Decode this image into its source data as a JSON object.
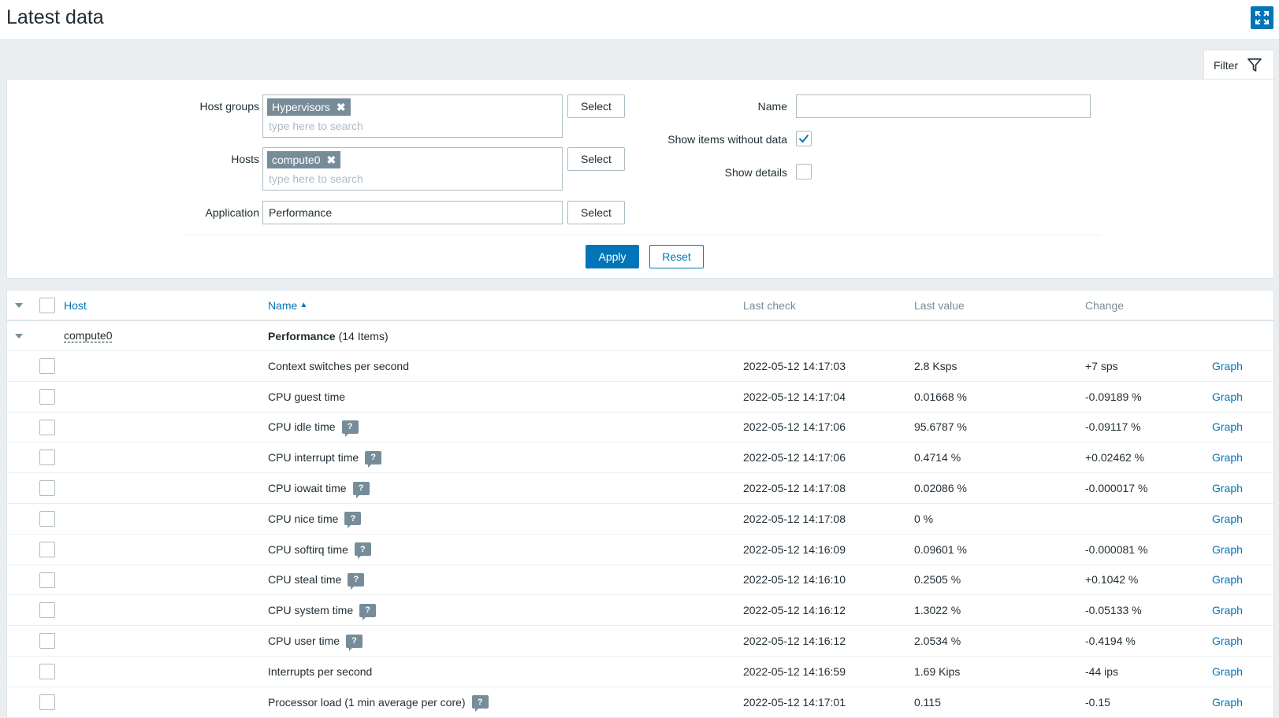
{
  "page": {
    "title": "Latest data"
  },
  "filter": {
    "tab_label": "Filter",
    "host_groups_label": "Host groups",
    "host_groups_tag": "Hypervisors",
    "hosts_label": "Hosts",
    "hosts_tag": "compute0",
    "search_placeholder": "type here to search",
    "application_label": "Application",
    "application_value": "Performance",
    "select_label": "Select",
    "name_label": "Name",
    "name_value": "",
    "show_items_without_data_label": "Show items without data",
    "show_items_without_data_checked": true,
    "show_details_label": "Show details",
    "show_details_checked": false,
    "apply_label": "Apply",
    "reset_label": "Reset"
  },
  "table": {
    "headers": {
      "host": "Host",
      "name": "Name",
      "sort_indicator": "▲",
      "last_check": "Last check",
      "last_value": "Last value",
      "change": "Change"
    },
    "group": {
      "host": "compute0",
      "application": "Performance",
      "count": "(14 Items)"
    },
    "graph_label": "Graph",
    "rows": [
      {
        "name": "Context switches per second",
        "hint": false,
        "last_check": "2022-05-12 14:17:03",
        "last_value": "2.8 Ksps",
        "change": "+7 sps"
      },
      {
        "name": "CPU guest time",
        "hint": false,
        "last_check": "2022-05-12 14:17:04",
        "last_value": "0.01668 %",
        "change": "-0.09189 %"
      },
      {
        "name": "CPU idle time",
        "hint": true,
        "last_check": "2022-05-12 14:17:06",
        "last_value": "95.6787 %",
        "change": "-0.09117 %"
      },
      {
        "name": "CPU interrupt time",
        "hint": true,
        "last_check": "2022-05-12 14:17:06",
        "last_value": "0.4714 %",
        "change": "+0.02462 %"
      },
      {
        "name": "CPU iowait time",
        "hint": true,
        "last_check": "2022-05-12 14:17:08",
        "last_value": "0.02086 %",
        "change": "-0.000017 %"
      },
      {
        "name": "CPU nice time",
        "hint": true,
        "last_check": "2022-05-12 14:17:08",
        "last_value": "0 %",
        "change": ""
      },
      {
        "name": "CPU softirq time",
        "hint": true,
        "last_check": "2022-05-12 14:16:09",
        "last_value": "0.09601 %",
        "change": "-0.000081 %"
      },
      {
        "name": "CPU steal time",
        "hint": true,
        "last_check": "2022-05-12 14:16:10",
        "last_value": "0.2505 %",
        "change": "+0.1042 %"
      },
      {
        "name": "CPU system time",
        "hint": true,
        "last_check": "2022-05-12 14:16:12",
        "last_value": "1.3022 %",
        "change": "-0.05133 %"
      },
      {
        "name": "CPU user time",
        "hint": true,
        "last_check": "2022-05-12 14:16:12",
        "last_value": "2.0534 %",
        "change": "-0.4194 %"
      },
      {
        "name": "Interrupts per second",
        "hint": false,
        "last_check": "2022-05-12 14:16:59",
        "last_value": "1.69 Kips",
        "change": "-44 ips"
      },
      {
        "name": "Processor load (1 min average per core)",
        "hint": true,
        "last_check": "2022-05-12 14:17:01",
        "last_value": "0.115",
        "change": "-0.15"
      }
    ]
  },
  "colors": {
    "accent": "#0275b8",
    "tag": "#768d99"
  }
}
